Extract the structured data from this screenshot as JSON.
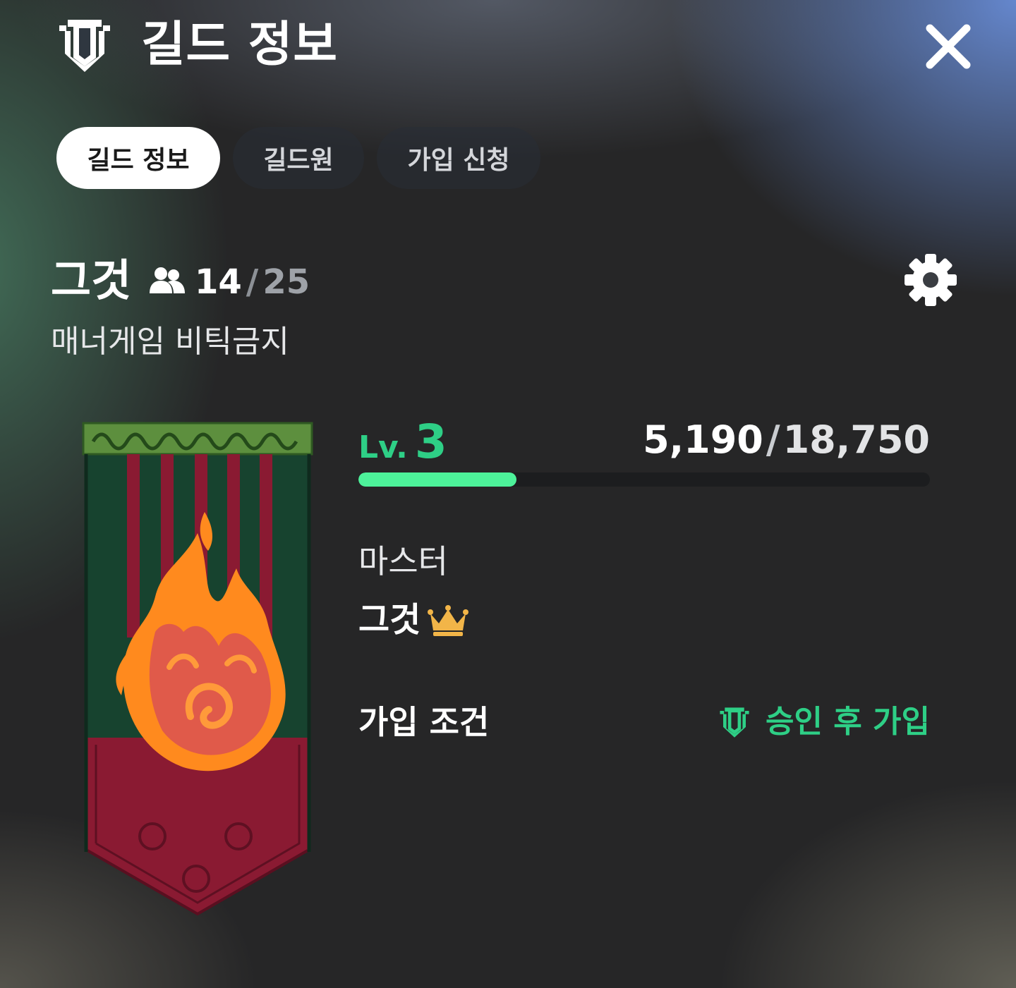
{
  "header": {
    "title": "길드 정보",
    "icon": "guild-shield-icon",
    "close_icon": "close-icon"
  },
  "tabs": [
    {
      "label": "길드 정보",
      "active": true
    },
    {
      "label": "길드원",
      "active": false
    },
    {
      "label": "가입 신청",
      "active": false
    }
  ],
  "guild": {
    "name": "그것",
    "members_icon": "members-icon",
    "member_count": "14",
    "member_sep": "/",
    "member_max": "25",
    "description": "매너게임 비틱금지",
    "settings_icon": "gear-icon",
    "banner": "guild-banner-flame-emblem"
  },
  "level": {
    "prefix": "Lv.",
    "value": "3",
    "xp_current": "5,190",
    "xp_sep": "/",
    "xp_max": "18,750",
    "progress_fraction": 0.277
  },
  "master": {
    "label": "마스터",
    "name": "그것",
    "crown_icon": "crown-icon"
  },
  "join": {
    "label": "가입 조건",
    "value": "승인 후 가입",
    "icon": "guild-shield-icon"
  },
  "colors": {
    "accent_green": "#2ecf86",
    "progress_fill": "#4df29a",
    "crown_gold": "#f2b548",
    "active_tab_bg": "#ffffff"
  }
}
